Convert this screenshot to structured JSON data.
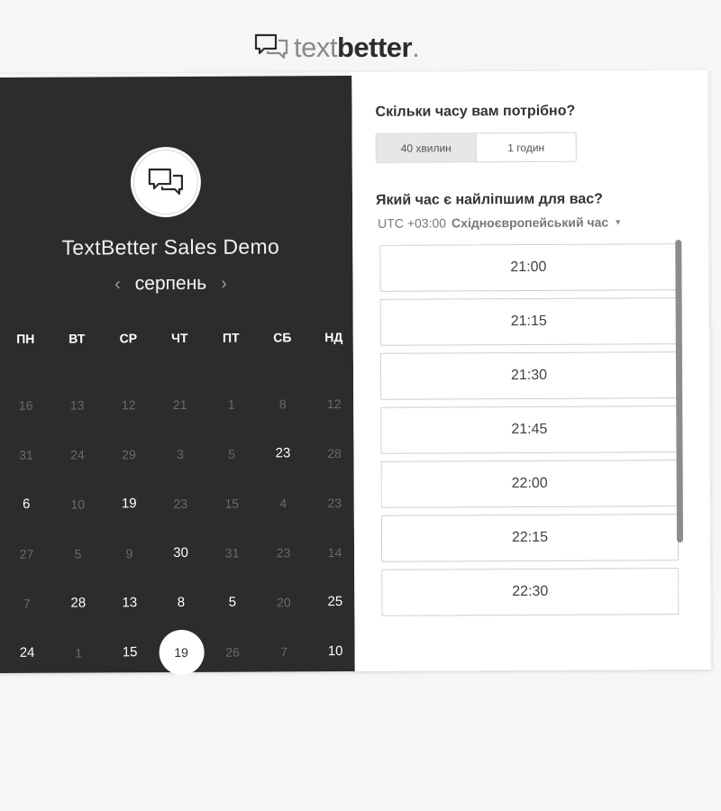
{
  "brand": {
    "name_light": "text",
    "name_bold": "better",
    "name_dot": "."
  },
  "event": {
    "title": "TextBetter Sales Demo"
  },
  "calendar": {
    "month": "серпень",
    "prev_icon": "chevron-left-icon",
    "next_icon": "chevron-right-icon",
    "weekdays": [
      "ПН",
      "ВТ",
      "СР",
      "ЧТ",
      "ПТ",
      "СБ",
      "НД"
    ],
    "days": [
      {
        "label": "16",
        "available": false
      },
      {
        "label": "13",
        "available": false
      },
      {
        "label": "12",
        "available": false
      },
      {
        "label": "21",
        "available": false
      },
      {
        "label": "1",
        "available": false
      },
      {
        "label": "8",
        "available": false
      },
      {
        "label": "12",
        "available": false
      },
      {
        "label": "31",
        "available": false
      },
      {
        "label": "24",
        "available": false
      },
      {
        "label": "29",
        "available": false
      },
      {
        "label": "3",
        "available": false
      },
      {
        "label": "5",
        "available": false
      },
      {
        "label": "23",
        "available": true
      },
      {
        "label": "28",
        "available": false
      },
      {
        "label": "6",
        "available": true
      },
      {
        "label": "10",
        "available": false
      },
      {
        "label": "19",
        "available": true
      },
      {
        "label": "23",
        "available": false
      },
      {
        "label": "15",
        "available": false
      },
      {
        "label": "4",
        "available": false
      },
      {
        "label": "23",
        "available": false
      },
      {
        "label": "27",
        "available": false
      },
      {
        "label": "5",
        "available": false
      },
      {
        "label": "9",
        "available": false
      },
      {
        "label": "30",
        "available": true
      },
      {
        "label": "31",
        "available": false
      },
      {
        "label": "23",
        "available": false
      },
      {
        "label": "14",
        "available": false
      },
      {
        "label": "7",
        "available": false
      },
      {
        "label": "28",
        "available": true
      },
      {
        "label": "13",
        "available": true
      },
      {
        "label": "8",
        "available": true
      },
      {
        "label": "5",
        "available": true
      },
      {
        "label": "20",
        "available": false
      },
      {
        "label": "25",
        "available": true
      },
      {
        "label": "24",
        "available": true
      },
      {
        "label": "1",
        "available": false
      },
      {
        "label": "15",
        "available": true
      },
      {
        "label": "19",
        "available": true,
        "selected": true
      },
      {
        "label": "26",
        "available": false
      },
      {
        "label": "7",
        "available": false
      },
      {
        "label": "10",
        "available": true
      }
    ]
  },
  "booking": {
    "duration_question": "Скільки часу вам потрібно?",
    "duration_options": [
      "40 хвилин",
      "1 годин"
    ],
    "duration_selected": "40 хвилин",
    "time_question": "Який час є найліпшим для вас?",
    "timezone_offset": "UTC +03:00",
    "timezone_name": "Східноєвропейський час",
    "timezone_caret_icon": "caret-down-icon",
    "slots": [
      "21:00",
      "21:15",
      "21:30",
      "21:45",
      "22:00",
      "22:15",
      "22:30",
      ""
    ]
  },
  "colors": {
    "left_panel": "#2c2c2c",
    "page_bg": "#f6f6f6"
  }
}
